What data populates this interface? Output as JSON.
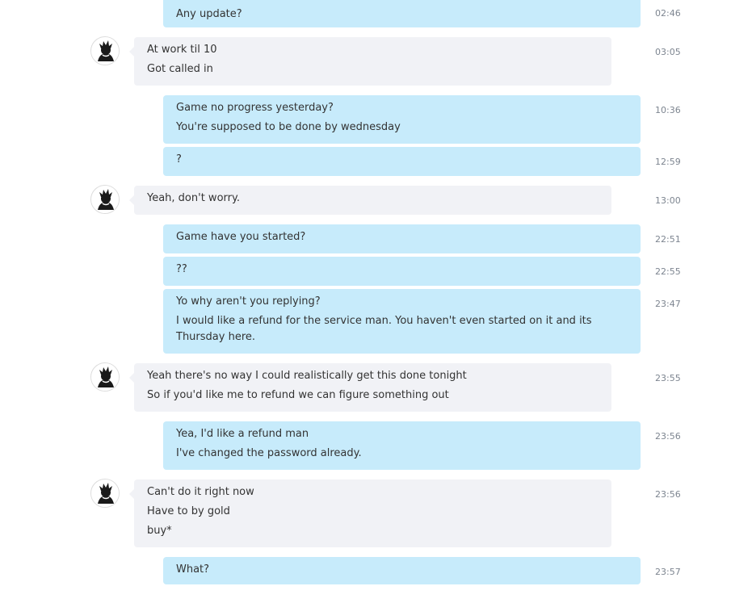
{
  "conversation": {
    "messages": [
      {
        "direction": "out",
        "time": "02:46",
        "lines": [
          "Any update?"
        ]
      },
      {
        "direction": "in",
        "time": "03:05",
        "lines": [
          "At work til 10",
          "Got called in"
        ]
      },
      {
        "direction": "out",
        "time": "10:36",
        "lines": [
          "Game no progress yesterday?",
          "You're supposed to be done by wednesday"
        ]
      },
      {
        "direction": "out",
        "time": "12:59",
        "lines": [
          "?"
        ]
      },
      {
        "direction": "in",
        "time": "13:00",
        "lines": [
          "Yeah, don't worry."
        ]
      },
      {
        "direction": "out",
        "time": "22:51",
        "lines": [
          "Game have you started?"
        ]
      },
      {
        "direction": "out",
        "time": "22:55",
        "lines": [
          "??"
        ]
      },
      {
        "direction": "out",
        "time": "23:47",
        "lines": [
          "Yo why aren't you replying?",
          "I would like a refund for the service man. You haven't even started on it and its Thursday here."
        ]
      },
      {
        "direction": "in",
        "time": "23:55",
        "lines": [
          "Yeah there's no way I could realistically get this done tonight",
          "So if you'd like me to refund we can figure something out"
        ]
      },
      {
        "direction": "out",
        "time": "23:56",
        "lines": [
          "Yea, I'd like a refund man",
          "I've changed the password already."
        ]
      },
      {
        "direction": "in",
        "time": "23:56",
        "lines": [
          "Can't do it right now",
          "Have to by gold",
          "buy*"
        ]
      },
      {
        "direction": "out",
        "time": "23:57",
        "lines": [
          "What?"
        ]
      }
    ]
  },
  "icons": {
    "avatar": "contact-avatar-icon"
  },
  "colors": {
    "outgoing_bubble": "#c7ebfb",
    "incoming_bubble": "#f1f2f6",
    "timestamp": "#7d8590",
    "text": "#333333"
  }
}
